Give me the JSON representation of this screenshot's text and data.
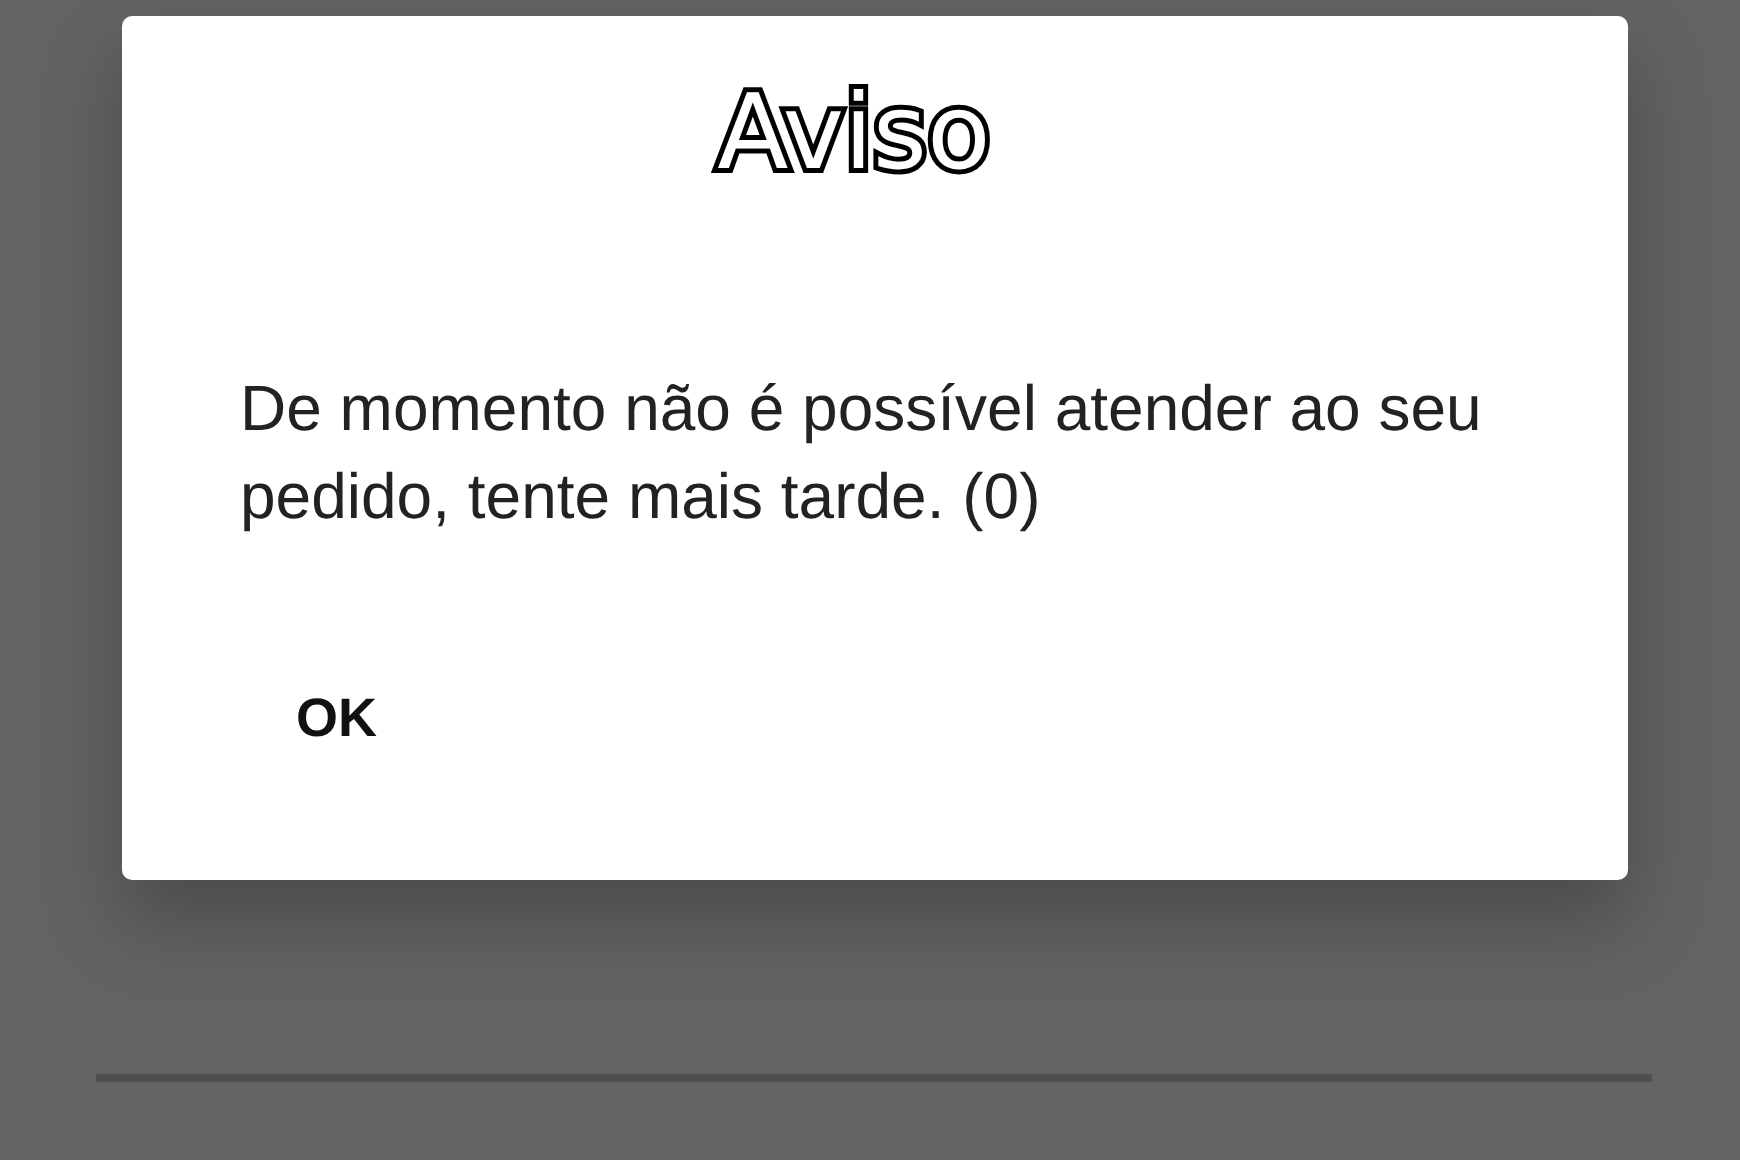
{
  "dialog": {
    "title": "Aviso",
    "message": "De momento não é possível atender ao seu pedido, tente mais tarde. (0)",
    "buttons": [
      "OK"
    ]
  }
}
